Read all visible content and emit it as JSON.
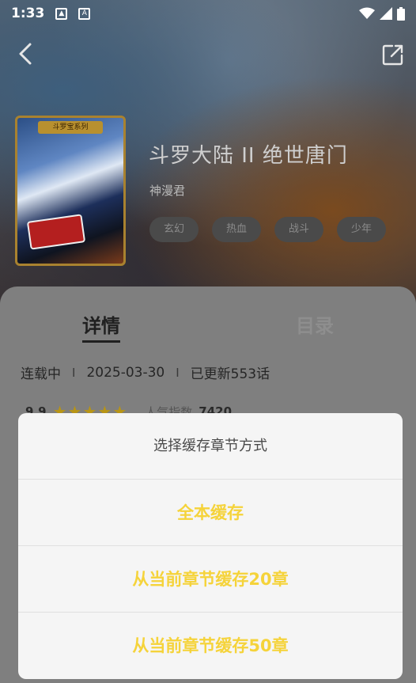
{
  "status_bar": {
    "time": "1:33",
    "icons": [
      "gallery-icon",
      "font-icon",
      "wifi-icon",
      "signal-icon",
      "battery-icon"
    ]
  },
  "nav": {
    "back_icon": "chevron-left-icon",
    "share_icon": "share-icon"
  },
  "comic": {
    "title": "斗罗大陆 II 绝世唐门",
    "author": "神漫君",
    "cover_banner": "斗罗宝系列",
    "tags": [
      "玄幻",
      "热血",
      "战斗",
      "少年"
    ]
  },
  "tabs": {
    "details": "详情",
    "catalog": "目录"
  },
  "meta": {
    "status": "连载中",
    "date": "2025-03-30",
    "updated": "已更新553话"
  },
  "rating": {
    "score": "9.9",
    "stars": 5,
    "popularity_label": "人气指数",
    "popularity_value": "7420"
  },
  "dialog": {
    "title": "选择缓存章节方式",
    "options": [
      "全本缓存",
      "从当前章节缓存20章",
      "从当前章节缓存50章"
    ]
  },
  "colors": {
    "accent": "#f5d33a",
    "star": "#b89515"
  }
}
